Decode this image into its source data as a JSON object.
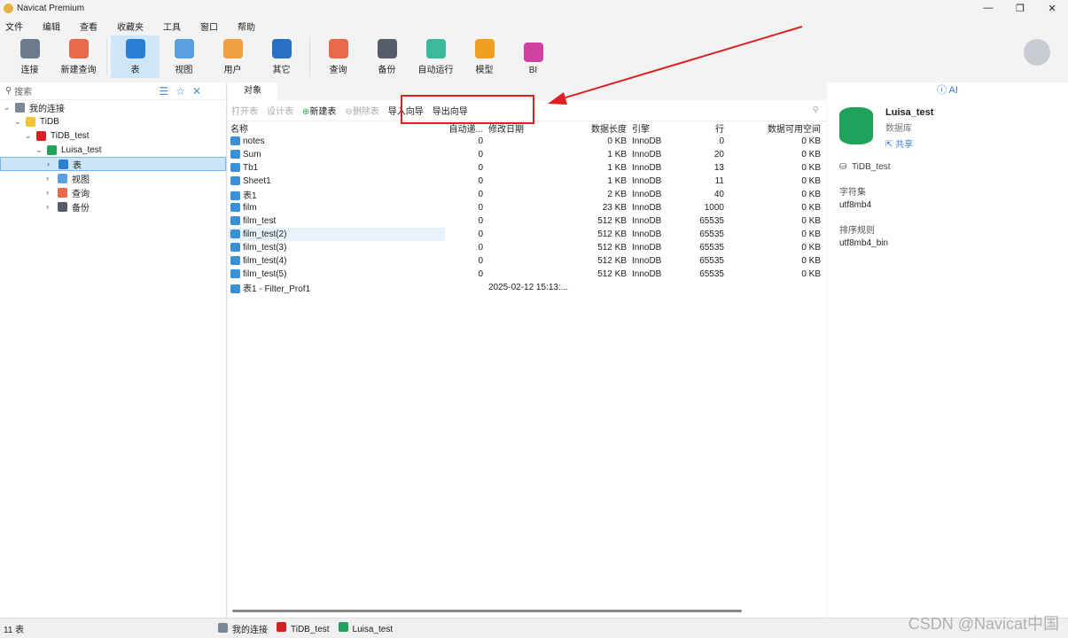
{
  "window": {
    "title": "Navicat Premium",
    "min": "—",
    "max": "❐",
    "close": "✕"
  },
  "menu": [
    "文件",
    "编辑",
    "查看",
    "收藏夹",
    "工具",
    "窗口",
    "帮助"
  ],
  "toolbar": [
    {
      "label": "连接",
      "color": "#6b7b8c"
    },
    {
      "label": "新建查询",
      "color": "#e8684a"
    },
    {
      "label": "表",
      "color": "#2a7fd4",
      "active": true
    },
    {
      "label": "视图",
      "color": "#5aa0e0"
    },
    {
      "label": "用户",
      "color": "#f0a040"
    },
    {
      "label": "其它",
      "color": "#2a6fc4"
    },
    {
      "label": "查询",
      "color": "#e8684a"
    },
    {
      "label": "备份",
      "color": "#555e68"
    },
    {
      "label": "自动运行",
      "color": "#3cb89a"
    },
    {
      "label": "模型",
      "color": "#f0a020"
    },
    {
      "label": "BI",
      "color": "#d040a0"
    }
  ],
  "sidebar": {
    "search_placeholder": "搜索",
    "tree": [
      {
        "label": "我的连接",
        "level": 0,
        "chev": "⌄",
        "color": "#7a8796"
      },
      {
        "label": "TiDB",
        "level": 1,
        "chev": "⌄",
        "color": "#f4c430"
      },
      {
        "label": "TiDB_test",
        "level": 2,
        "chev": "⌄",
        "color": "#d42020"
      },
      {
        "label": "Luisa_test",
        "level": 3,
        "chev": "⌄",
        "color": "#1fa35a"
      },
      {
        "label": "表",
        "level": 4,
        "chev": "›",
        "color": "#2a7fd4",
        "selected": true
      },
      {
        "label": "视图",
        "level": 4,
        "chev": "›",
        "color": "#5aa0e0"
      },
      {
        "label": "查询",
        "level": 4,
        "chev": "›",
        "color": "#e8684a"
      },
      {
        "label": "备份",
        "level": 4,
        "chev": "›",
        "color": "#555e68"
      }
    ]
  },
  "main": {
    "tab": "对象",
    "actions": {
      "open": "打开表",
      "design": "设计表",
      "new": "新建表",
      "delete": "删除表",
      "import": "导入向导",
      "export": "导出向导"
    },
    "columns": [
      "名称",
      "自动递...",
      "修改日期",
      "数据长度",
      "引擎",
      "行",
      "数据可用空间"
    ],
    "rows": [
      [
        "notes",
        "0",
        "",
        "0 KB",
        "InnoDB",
        "0",
        "0 KB"
      ],
      [
        "Sum",
        "0",
        "",
        "1 KB",
        "InnoDB",
        "20",
        "0 KB"
      ],
      [
        "Tb1",
        "0",
        "",
        "1 KB",
        "InnoDB",
        "13",
        "0 KB"
      ],
      [
        "Sheet1",
        "0",
        "",
        "1 KB",
        "InnoDB",
        "11",
        "0 KB"
      ],
      [
        "表1",
        "0",
        "",
        "2 KB",
        "InnoDB",
        "40",
        "0 KB"
      ],
      [
        "film",
        "0",
        "",
        "23 KB",
        "InnoDB",
        "1000",
        "0 KB"
      ],
      [
        "film_test",
        "0",
        "",
        "512 KB",
        "InnoDB",
        "65535",
        "0 KB"
      ],
      [
        "film_test(2)",
        "0",
        "",
        "512 KB",
        "InnoDB",
        "65535",
        "0 KB"
      ],
      [
        "film_test(3)",
        "0",
        "",
        "512 KB",
        "InnoDB",
        "65535",
        "0 KB"
      ],
      [
        "film_test(4)",
        "0",
        "",
        "512 KB",
        "InnoDB",
        "65535",
        "0 KB"
      ],
      [
        "film_test(5)",
        "0",
        "",
        "512 KB",
        "InnoDB",
        "65535",
        "0 KB"
      ],
      [
        "表1 - Filter_Prof1",
        "",
        "2025-02-12 15:13:...",
        "",
        "",
        "",
        ""
      ]
    ]
  },
  "info": {
    "tabs": "ⓘ  AI",
    "name": "Luisa_test",
    "type": "数据库",
    "share": "共享",
    "server": "TiDB_test",
    "charset_label": "字符集",
    "charset": "utf8mb4",
    "collation_label": "排序规则",
    "collation": "utf8mb4_bin"
  },
  "status": {
    "count": "11 表",
    "crumbs": [
      "我的连接",
      "TiDB_test",
      "Luisa_test"
    ]
  },
  "watermark": "CSDN @Navicat中国",
  "colors": {
    "highlight": "#e02020",
    "accent": "#2a7fd4"
  }
}
